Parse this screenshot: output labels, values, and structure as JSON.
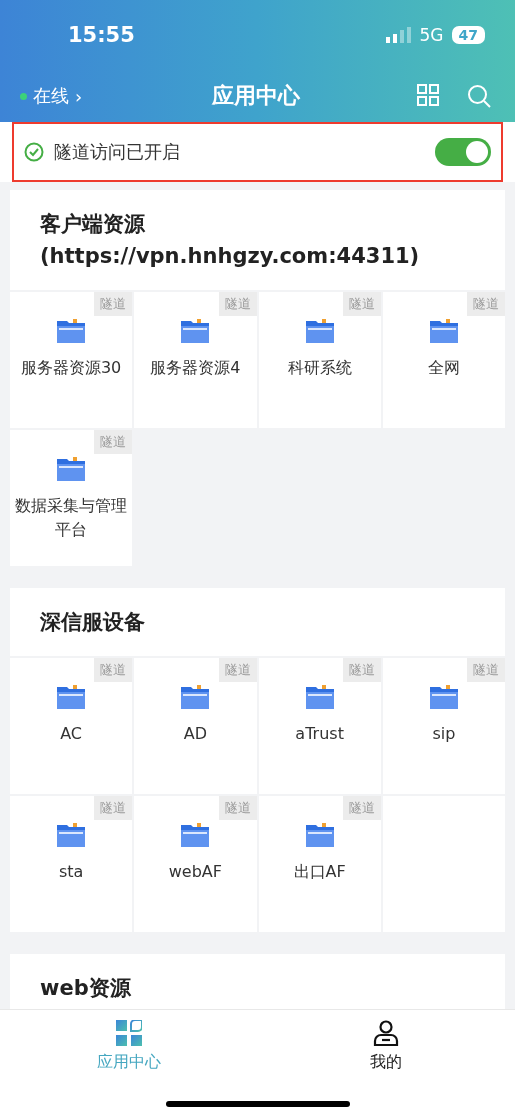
{
  "status_bar": {
    "time": "15:55",
    "network": "5G",
    "battery": "47"
  },
  "nav": {
    "status": "在线",
    "chevron": "›",
    "title": "应用中心"
  },
  "tunnel": {
    "label": "隧道访问已开启",
    "on": true,
    "highlighted": true
  },
  "sections": [
    {
      "title": "客户端资源(https://vpn.hnhgzy.com:44311)",
      "tiles": [
        {
          "name": "服务器资源30",
          "badge": "隧道"
        },
        {
          "name": "服务器资源4",
          "badge": "隧道"
        },
        {
          "name": "科研系统",
          "badge": "隧道"
        },
        {
          "name": "全网",
          "badge": "隧道"
        },
        {
          "name": "数据采集与管理平台",
          "badge": "隧道"
        }
      ]
    },
    {
      "title": "深信服设备",
      "tiles": [
        {
          "name": "AC",
          "badge": "隧道"
        },
        {
          "name": "AD",
          "badge": "隧道"
        },
        {
          "name": "aTrust",
          "badge": "隧道"
        },
        {
          "name": "sip",
          "badge": "隧道"
        },
        {
          "name": "sta",
          "badge": "隧道"
        },
        {
          "name": "webAF",
          "badge": "隧道"
        },
        {
          "name": "出口AF",
          "badge": "隧道"
        }
      ]
    },
    {
      "title": "web资源"
    }
  ],
  "tab_bar": [
    {
      "label": "应用中心",
      "selected": true
    },
    {
      "label": "我的",
      "selected": false
    }
  ]
}
